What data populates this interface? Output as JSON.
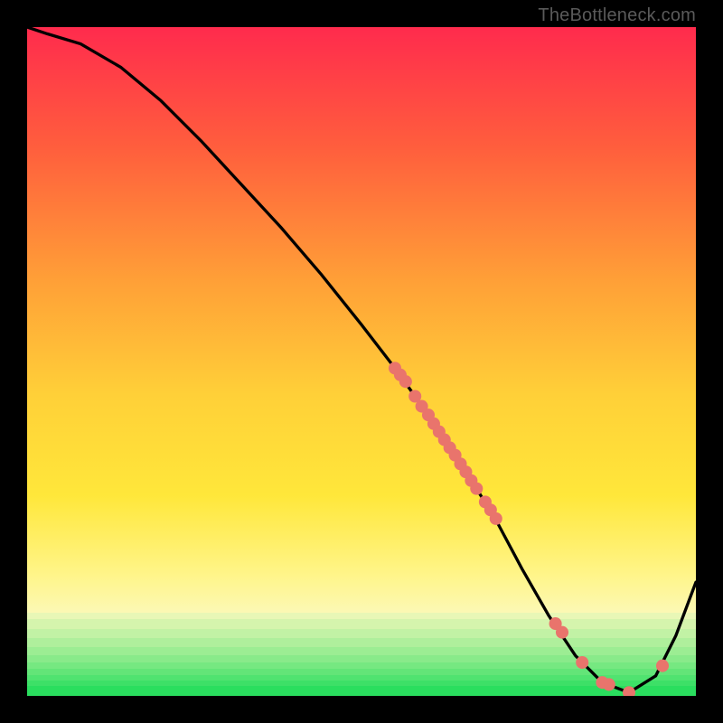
{
  "attribution": "TheBottleneck.com",
  "colors": {
    "dot": "#e9746c",
    "curve": "#000000",
    "green": "#2ade5e",
    "red_top": "#ff2b4d",
    "yellow_mid": "#ffe73a",
    "cream": "#fbf9bf"
  },
  "chart_data": {
    "type": "line",
    "title": "",
    "xlabel": "",
    "ylabel": "",
    "xlim": [
      0,
      100
    ],
    "ylim": [
      0,
      100
    ],
    "grid": false,
    "legend": false,
    "series": [
      {
        "name": "bottleneck-curve",
        "x": [
          0,
          3,
          8,
          14,
          20,
          26,
          32,
          38,
          44,
          50,
          55,
          60,
          65,
          70,
          74,
          78,
          82,
          86,
          90,
          94,
          97,
          100
        ],
        "y": [
          100,
          99,
          97.5,
          94,
          89,
          83,
          76.5,
          70,
          63,
          55.5,
          49,
          42,
          34.5,
          26.5,
          19,
          12,
          6,
          2,
          0.5,
          3,
          9,
          17
        ]
      }
    ],
    "points_on_curve": [
      {
        "name": "cluster-upper",
        "x": [
          55.0,
          55.8,
          56.6
        ],
        "y": [
          49.0,
          48.0,
          47.0
        ]
      },
      {
        "name": "cluster-mid",
        "x": [
          58.0,
          59.0,
          60.0,
          60.8,
          61.6,
          62.4,
          63.2,
          64.0,
          64.8,
          65.6,
          66.4,
          67.2
        ],
        "y": [
          44.8,
          43.3,
          42.0,
          40.7,
          39.5,
          38.3,
          37.1,
          36.0,
          34.7,
          33.5,
          32.2,
          31.0
        ]
      },
      {
        "name": "cluster-low",
        "x": [
          68.5,
          69.3,
          70.1
        ],
        "y": [
          29.0,
          27.8,
          26.5
        ]
      },
      {
        "name": "valley-left",
        "x": [
          79.0,
          80.0
        ],
        "y": [
          10.8,
          9.5
        ]
      },
      {
        "name": "valley-bottom",
        "x": [
          83.0,
          86.0,
          87.0,
          90.0
        ],
        "y": [
          5.0,
          2.0,
          1.7,
          0.5
        ]
      },
      {
        "name": "valley-right",
        "x": [
          95.0
        ],
        "y": [
          4.5
        ]
      }
    ],
    "green_bands_y_ranges": [
      [
        11.5,
        12.5
      ],
      [
        10.0,
        11.5
      ],
      [
        8.6,
        10.0
      ],
      [
        7.3,
        8.6
      ],
      [
        6.1,
        7.3
      ],
      [
        5.0,
        6.1
      ],
      [
        4.0,
        5.0
      ],
      [
        3.1,
        4.0
      ],
      [
        2.3,
        3.1
      ],
      [
        1.5,
        2.3
      ],
      [
        0.0,
        1.5
      ]
    ]
  }
}
